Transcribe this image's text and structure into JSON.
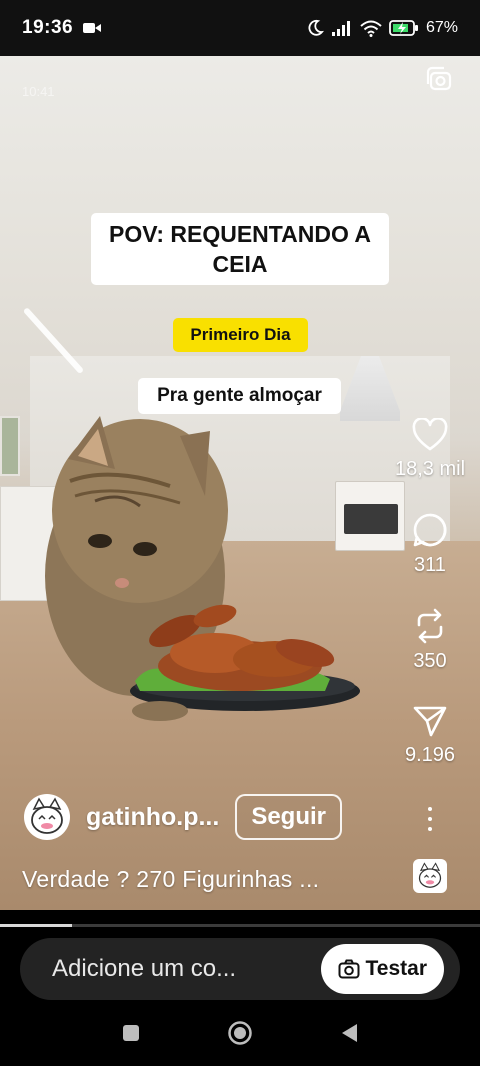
{
  "status_bar": {
    "time": "19:36",
    "battery": "67%",
    "icons": [
      "video-record-icon",
      "moon-icon",
      "signal-icon",
      "wifi-icon",
      "battery-charging-icon"
    ]
  },
  "video": {
    "faded_timestamp": "10:41",
    "captions": {
      "title": "POV: REQUENTANDO A CEIA",
      "day_label": "Primeiro Dia",
      "subtitle": "Pra gente almoçar"
    }
  },
  "actions": {
    "likes": "18,3 mil",
    "comments": "311",
    "reposts": "350",
    "shares": "9.196"
  },
  "author": {
    "username": "gatinho.p...",
    "follow_label": "Seguir"
  },
  "description": "Verdade ? 270 Figurinhas ...",
  "progress": 0.15,
  "comment_bar": {
    "placeholder": "Adicione um co...",
    "try_label": "Testar"
  },
  "colors": {
    "day_caption_bg": "#f9e000",
    "comment_bar_bg": "#232323"
  }
}
